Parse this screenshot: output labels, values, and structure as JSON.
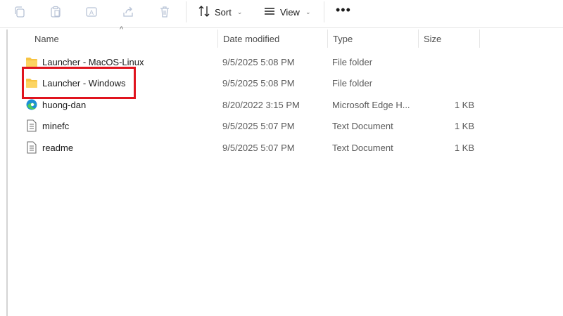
{
  "toolbar": {
    "sort_label": "Sort",
    "view_label": "View",
    "more_label": "•••",
    "icons": [
      "copy-icon",
      "paste-icon",
      "rename-icon",
      "share-icon",
      "delete-icon",
      "sort-icon",
      "view-icon"
    ]
  },
  "columns": {
    "name": "Name",
    "date": "Date modified",
    "type": "Type",
    "size": "Size",
    "sort_indicator": "^"
  },
  "files": [
    {
      "name": "Launcher - MacOS-Linux",
      "date": "9/5/2025 5:08 PM",
      "type": "File folder",
      "size": "",
      "icon": "folder-icon"
    },
    {
      "name": "Launcher - Windows",
      "date": "9/5/2025 5:08 PM",
      "type": "File folder",
      "size": "",
      "icon": "folder-icon"
    },
    {
      "name": "huong-dan",
      "date": "8/20/2022 3:15 PM",
      "type": "Microsoft Edge H...",
      "size": "1 KB",
      "icon": "edge-icon"
    },
    {
      "name": "minefc",
      "date": "9/5/2025 5:07 PM",
      "type": "Text Document",
      "size": "1 KB",
      "icon": "text-document-icon"
    },
    {
      "name": "readme",
      "date": "9/5/2025 5:07 PM",
      "type": "Text Document",
      "size": "1 KB",
      "icon": "text-document-icon"
    }
  ],
  "colors": {
    "highlight": "#e0141e",
    "folder": "#f7c443"
  }
}
